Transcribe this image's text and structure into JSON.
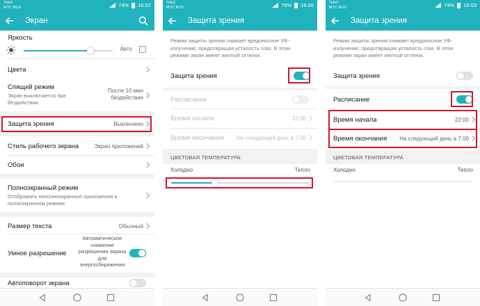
{
  "status": {
    "operator_line1": "Tele2",
    "operator_line2": "МТС RUS",
    "p1": {
      "battery": "74%",
      "time": "16:02"
    },
    "p2": {
      "battery": "76%",
      "time": "16:06"
    },
    "p3": {
      "battery": "74%",
      "time": "16:03"
    }
  },
  "screen1": {
    "title": "Экран",
    "brightness_label": "Яркость",
    "brightness_level": 0.75,
    "auto_label": "Авто",
    "colors_label": "Цвета",
    "sleep_label": "Спящий режим",
    "sleep_sub": "Экран выключается при бездействии",
    "sleep_value_1": "После 10 мин",
    "sleep_value_2": "бездействия",
    "eye_label": "Защита зрения",
    "eye_value": "Выключено",
    "desktop_style_label": "Стиль рабочего экрана",
    "desktop_style_value": "Экран приложений",
    "wallpaper_label": "Обои",
    "fullscreen_label": "Полноэкранный режим",
    "fullscreen_sub": "Отображать неполноэкранные приложения в полноэкранном режиме",
    "text_size_label": "Размер текста",
    "text_size_value": "Обычный",
    "smart_res_label": "Умное разрешение",
    "smart_res_desc": "Автоматическое снижение разрешения экрана для энергосбережения",
    "autorotate_label": "Автоповорот экрана"
  },
  "screen2": {
    "title": "Защита зрения",
    "description": "Режим защиты зрения снижает вредоносное УФ-излучение, предотвращая усталость глаз. В этом режиме экран имеет желтый оттенок.",
    "eye_toggle_label": "Защита зрения",
    "schedule_label": "Расписание",
    "start_label": "Время начала",
    "start_value": "22:00",
    "end_label": "Время окончания",
    "end_value": "На следующий день в 7:00",
    "color_temp_header": "ЦВЕТОВАЯ ТЕМПЕРАТУРА",
    "cold_label": "Холодно",
    "warm_label": "Тепло",
    "temp_level": 0.32
  },
  "screen3": {
    "title": "Защита зрения",
    "description": "Режим защиты зрения снижает вредоносное УФ-излучение, предотвращая усталость глаз. В этом режиме экран имеет желтый оттенок.",
    "eye_toggle_label": "Защита зрения",
    "schedule_label": "Расписание",
    "start_label": "Время начала",
    "start_value": "22:00",
    "end_label": "Время окончания",
    "end_value": "На следующий день в 7:00",
    "color_temp_header": "ЦВЕТОВАЯ ТЕМПЕРАТУРА",
    "cold_label": "Холодно",
    "warm_label": "Тепло"
  },
  "colors": {
    "accent": "#20b2bd",
    "highlight": "#d3132b"
  },
  "icons": [
    "back-arrow-icon",
    "search-icon",
    "brightness-icon",
    "chevron-right-icon",
    "nav-back-icon",
    "nav-home-icon",
    "nav-recents-icon",
    "signal-icon",
    "battery-icon"
  ]
}
